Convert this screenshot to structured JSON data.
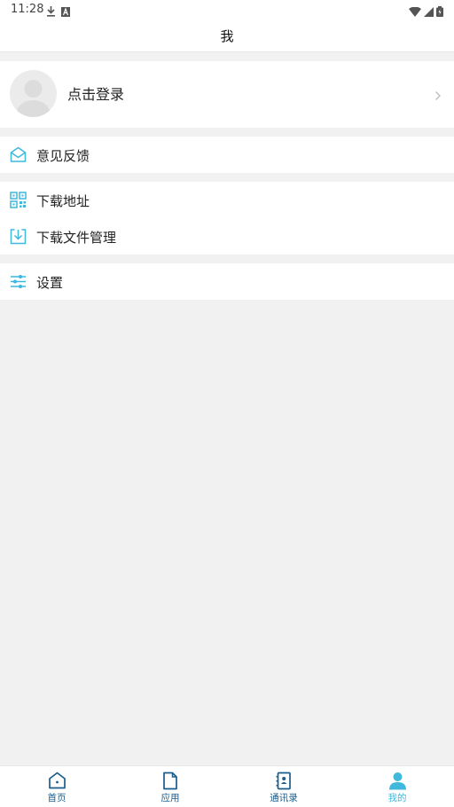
{
  "status_bar": {
    "time": "11:28"
  },
  "header": {
    "title": "我"
  },
  "profile": {
    "login_label": "点击登录"
  },
  "menu": {
    "feedback": "意见反馈",
    "download_address": "下载地址",
    "download_file_manage": "下载文件管理",
    "settings": "设置"
  },
  "bottom_nav": {
    "items": [
      {
        "label": "首页",
        "icon": "home-icon",
        "active": false
      },
      {
        "label": "应用",
        "icon": "document-icon",
        "active": false
      },
      {
        "label": "通讯录",
        "icon": "contacts-icon",
        "active": false
      },
      {
        "label": "我的",
        "icon": "person-icon",
        "active": true
      }
    ]
  },
  "colors": {
    "accent": "#3fb8dc",
    "nav_icon": "#1a5c8c",
    "background": "#f1f1f1"
  }
}
